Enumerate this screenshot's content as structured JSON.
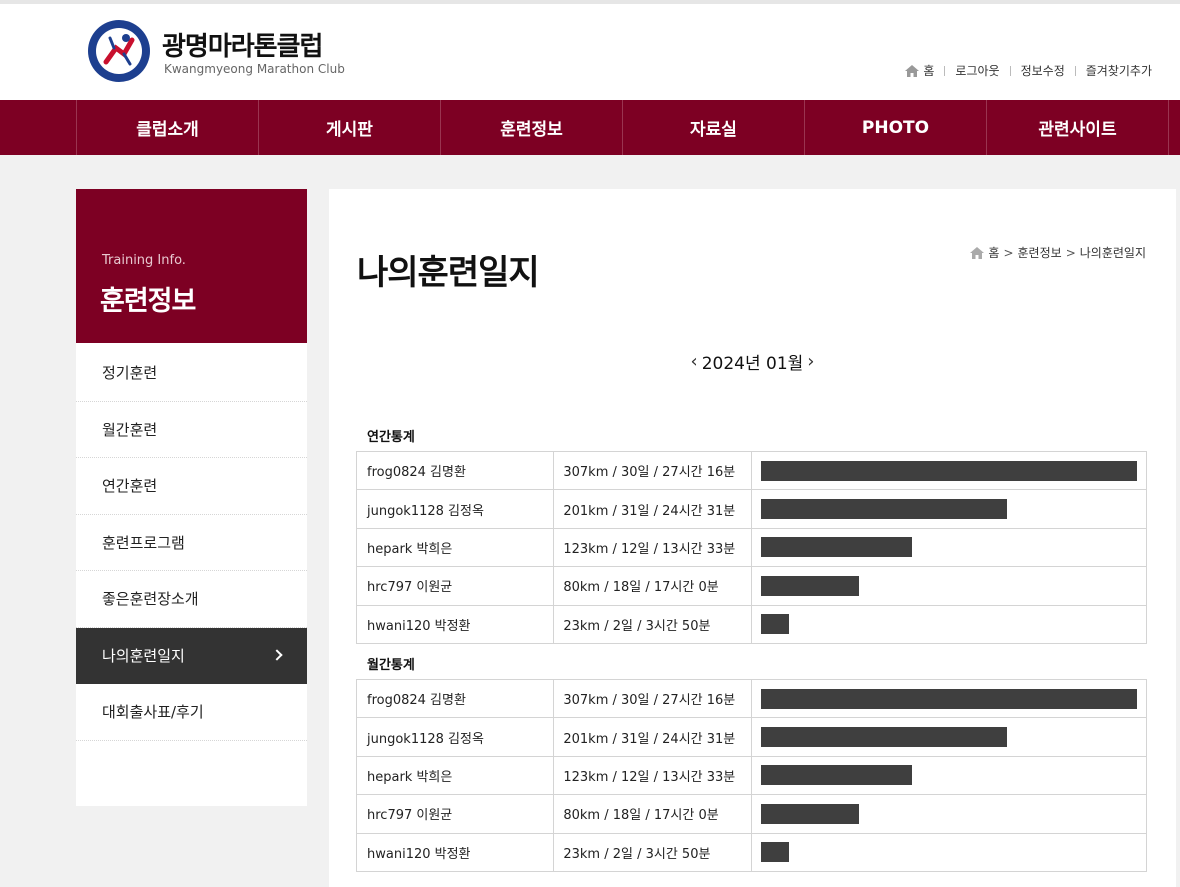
{
  "header": {
    "logo_title": "광명마라톤클럽",
    "logo_sub": "Kwangmyeong Marathon Club",
    "logo_ring_text": "www.kmc2001.co.kr",
    "links": [
      "홈",
      "로그아웃",
      "정보수정",
      "즐겨찾기추가"
    ]
  },
  "nav": {
    "items": [
      "클럽소개",
      "게시판",
      "훈련정보",
      "자료실",
      "PHOTO",
      "관련사이트"
    ]
  },
  "sidebar": {
    "head_en": "Training Info.",
    "head_ko": "훈련정보",
    "items": [
      "정기훈련",
      "월간훈련",
      "연간훈련",
      "훈련프로그램",
      "좋은훈련장소개",
      "나의훈련일지",
      "대회출사표/후기"
    ],
    "active_index": 5
  },
  "main": {
    "title": "나의훈련일지",
    "breadcrumb": [
      "홈",
      "훈련정보",
      "나의훈련일지"
    ],
    "period": "2024년 01월",
    "sections": [
      {
        "label": "연간통계",
        "rows": [
          {
            "name": "frog0824 김명환",
            "value": "307km / 30일 / 27시간 16분",
            "km": 307
          },
          {
            "name": "jungok1128 김정옥",
            "value": "201km / 31일 / 24시간 31분",
            "km": 201
          },
          {
            "name": "hepark 박희은",
            "value": "123km / 12일 / 13시간 33분",
            "km": 123
          },
          {
            "name": "hrc797 이원균",
            "value": "80km / 18일 / 17시간 0분",
            "km": 80
          },
          {
            "name": "hwani120 박정환",
            "value": "23km / 2일 / 3시간 50분",
            "km": 23
          }
        ]
      },
      {
        "label": "월간통계",
        "rows": [
          {
            "name": "frog0824 김명환",
            "value": "307km / 30일 / 27시간 16분",
            "km": 307
          },
          {
            "name": "jungok1128 김정옥",
            "value": "201km / 31일 / 24시간 31분",
            "km": 201
          },
          {
            "name": "hepark 박희은",
            "value": "123km / 12일 / 13시간 33분",
            "km": 123
          },
          {
            "name": "hrc797 이원균",
            "value": "80km / 18일 / 17시간 0분",
            "km": 80
          },
          {
            "name": "hwani120 박정환",
            "value": "23km / 2일 / 3시간 50분",
            "km": 23
          }
        ]
      }
    ]
  },
  "colors": {
    "brand": "#7d0023",
    "bar": "#3f3f3f",
    "active_side": "#333333"
  }
}
